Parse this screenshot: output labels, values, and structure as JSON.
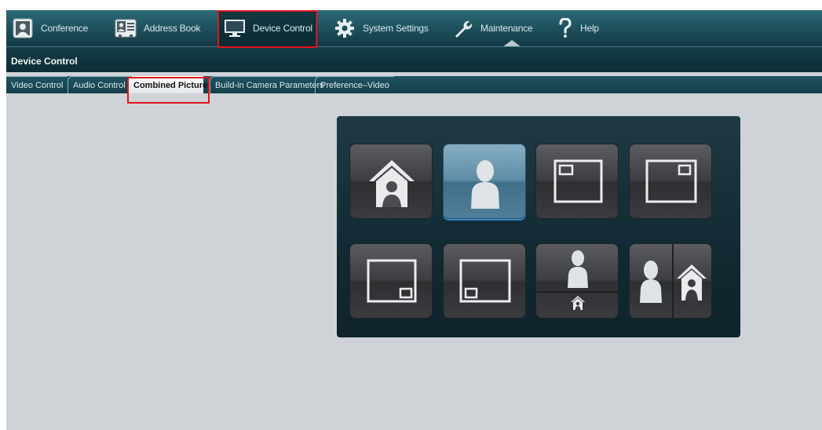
{
  "nav": {
    "items": [
      {
        "label": "Conference",
        "icon": "conference-icon"
      },
      {
        "label": "Address Book",
        "icon": "address-book-icon"
      },
      {
        "label": "Device Control",
        "icon": "monitor-icon"
      },
      {
        "label": "System Settings",
        "icon": "gear-icon"
      },
      {
        "label": "Maintenance",
        "icon": "wrench-icon"
      },
      {
        "label": "Help",
        "icon": "question-icon"
      }
    ],
    "active": "Device Control"
  },
  "section": {
    "title": "Device Control"
  },
  "tabs": [
    {
      "label": "Video Control"
    },
    {
      "label": "Audio Control"
    },
    {
      "label": "Combined Picture"
    },
    {
      "label": "Build-in Camera Parameters"
    },
    {
      "label": "Preference–Video"
    }
  ],
  "active_tab": "Combined Picture",
  "layouts": [
    {
      "icon": "house-icon",
      "selected": false
    },
    {
      "icon": "person-icon",
      "selected": true
    },
    {
      "icon": "pip-top-left-icon",
      "selected": false
    },
    {
      "icon": "pip-top-right-icon",
      "selected": false
    },
    {
      "icon": "pip-bottom-right-icon",
      "selected": false
    },
    {
      "icon": "pip-bottom-left-icon",
      "selected": false
    },
    {
      "icon": "split-vertical-person-house-icon",
      "selected": false
    },
    {
      "icon": "split-horizontal-person-house-icon",
      "selected": false
    }
  ],
  "colors": {
    "nav_bg": "#1d4e5b",
    "highlight_border": "#e0141e",
    "selected_button": "#5e8ca6",
    "panel_bg": "#1d3a45",
    "page_bg": "#cfd3d7"
  }
}
